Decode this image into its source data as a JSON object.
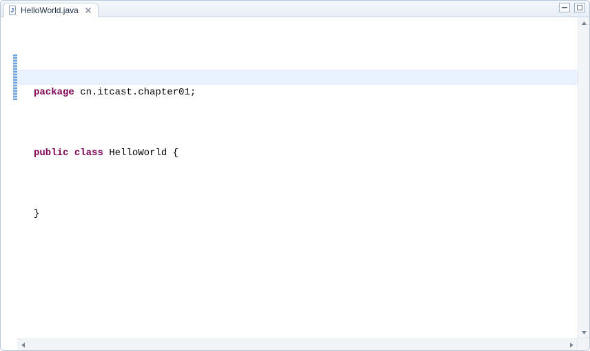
{
  "tab": {
    "filename": "HelloWorld.java",
    "file_icon": "java-file-icon",
    "close_icon": "close-icon"
  },
  "window_controls": {
    "minimize": "minimize-icon",
    "maximize": "maximize-icon"
  },
  "code": {
    "line1": {
      "kw": "package",
      "rest": " cn.itcast.chapter01;"
    },
    "line2": "",
    "line3": {
      "kw1": "public",
      "kw2": "class",
      "rest": " HelloWorld {"
    },
    "line4": "\t",
    "line5": "}"
  },
  "editor": {
    "active_line_index": 3,
    "fold_range_start_line": 3,
    "fold_range_end_line": 5
  },
  "colors": {
    "keyword": "#7f0055",
    "text": "#000000",
    "highlight": "#e8f2fe",
    "fold_marker": "#6fa3e0"
  }
}
